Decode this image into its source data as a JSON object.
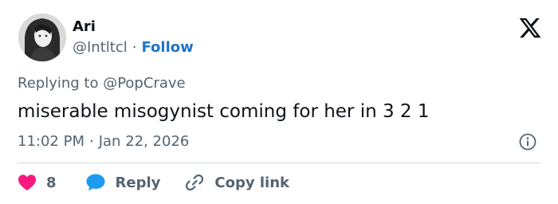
{
  "author": {
    "display_name": "Ari",
    "handle": "@Intltcl",
    "separator": "·",
    "follow_label": "Follow"
  },
  "tweet": {
    "replying_to": "Replying to @PopCrave",
    "text": "miserable misogynist coming for her in 3 2 1",
    "time": "11:02 PM",
    "time_separator": "·",
    "date": "Jan 22, 2026"
  },
  "actions": {
    "like_count": "8",
    "reply_label": "Reply",
    "copy_link_label": "Copy link"
  },
  "colors": {
    "like": "#f91880",
    "reply": "#1d9bf0",
    "follow": "#1d74c8",
    "muted_text": "#536471"
  },
  "icons": {
    "brand": "x-logo-icon",
    "info": "info-icon",
    "like": "heart-icon",
    "reply": "speech-bubble-icon",
    "copy_link": "link-icon"
  }
}
